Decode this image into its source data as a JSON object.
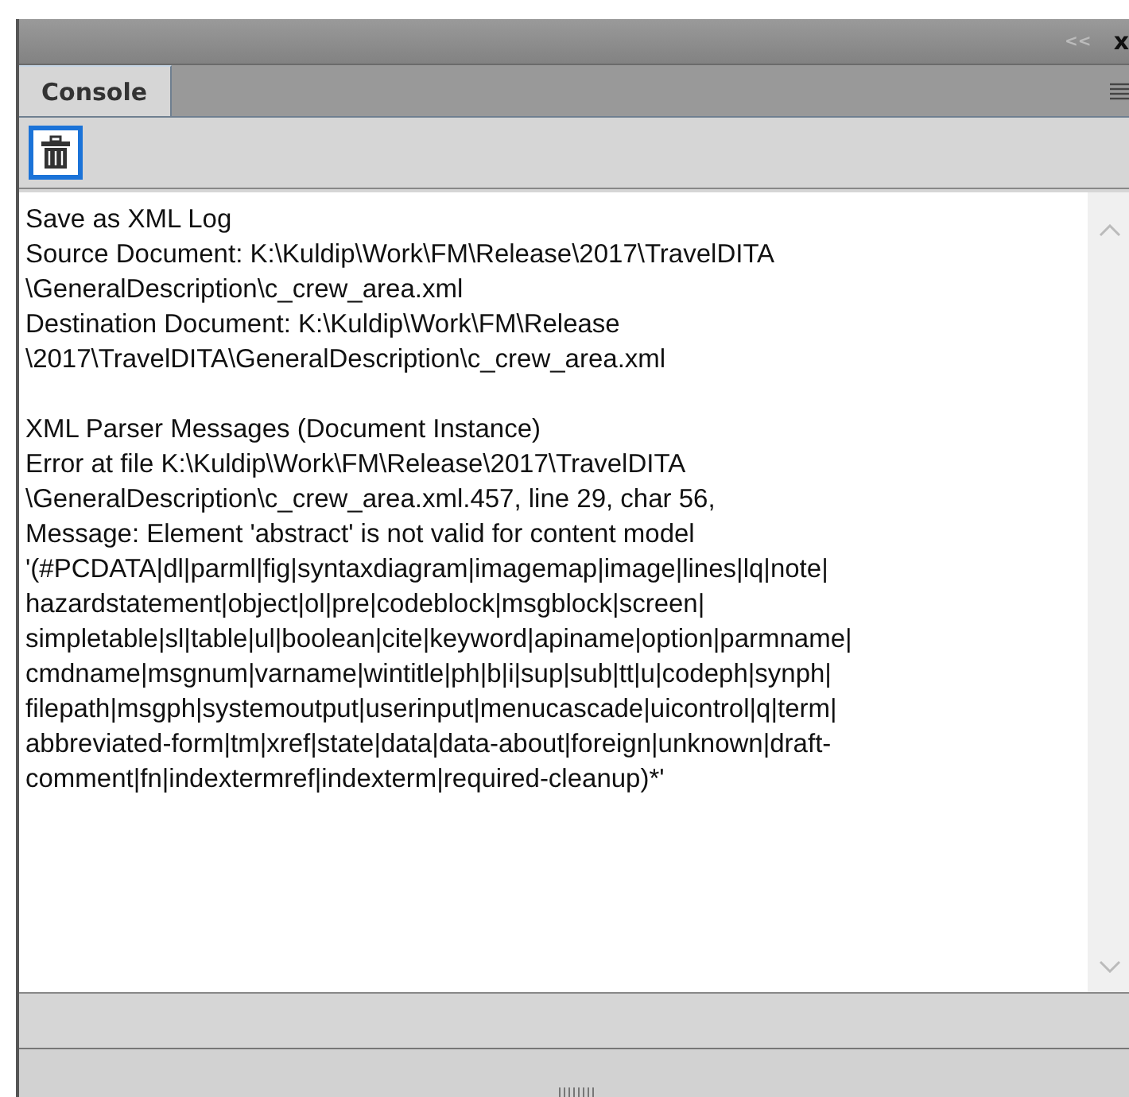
{
  "panel": {
    "collapse_glyph": "<<",
    "close_glyph": "x"
  },
  "tabs": [
    {
      "label": "Console",
      "selected": true
    }
  ],
  "log": [
    {
      "lines": [
        "Save as XML Log",
        "Source Document: K:\\Kuldip\\Work\\FM\\Release\\2017\\TravelDITA",
        "\\GeneralDescription\\c_crew_area.xml",
        "Destination Document: K:\\Kuldip\\Work\\FM\\Release",
        "\\2017\\TravelDITA\\GeneralDescription\\c_crew_area.xml"
      ]
    },
    {
      "lines": [
        "XML Parser Messages (Document Instance)",
        "Error at file K:\\Kuldip\\Work\\FM\\Release\\2017\\TravelDITA",
        "\\GeneralDescription\\c_crew_area.xml.457, line 29, char 56,",
        "Message: Element 'abstract' is not valid for content model",
        "'(#PCDATA|dl|parml|fig|syntaxdiagram|imagemap|image|lines|lq|note|",
        "hazardstatement|object|ol|pre|codeblock|msgblock|screen|",
        "simpletable|sl|table|ul|boolean|cite|keyword|apiname|option|parmname|",
        "cmdname|msgnum|varname|wintitle|ph|b|i|sup|sub|tt|u|codeph|synph|",
        "filepath|msgph|systemoutput|userinput|menucascade|uicontrol|q|term|",
        "abbreviated-form|tm|xref|state|data|data-about|foreign|unknown|draft-",
        "comment|fn|indextermref|indexterm|required-cleanup)*'"
      ]
    }
  ]
}
